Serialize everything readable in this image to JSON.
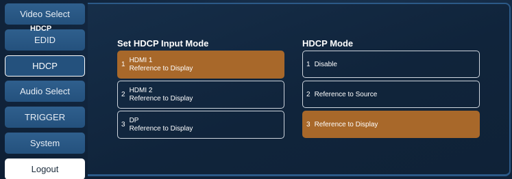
{
  "sidebar": {
    "items": [
      {
        "label": "Video Select",
        "active": false
      },
      {
        "label": "EDID",
        "active": false
      },
      {
        "label": "HDCP",
        "active": true
      },
      {
        "label": "Audio Select",
        "active": false
      },
      {
        "label": "TRIGGER",
        "active": false
      },
      {
        "label": "System",
        "active": false
      }
    ],
    "logout_label": "Logout"
  },
  "panel": {
    "title": "HDCP",
    "input_mode_heading": "Set HDCP Input Mode",
    "hdcp_mode_heading": "HDCP Mode",
    "inputs": [
      {
        "number": "1",
        "name": "HDMI 1",
        "mode": "Reference to Display",
        "selected": true
      },
      {
        "number": "2",
        "name": "HDMI 2",
        "mode": "Reference to Display",
        "selected": false
      },
      {
        "number": "3",
        "name": "DP",
        "mode": "Reference to Display",
        "selected": false
      }
    ],
    "modes": [
      {
        "number": "1",
        "label": "Disable",
        "selected": false
      },
      {
        "number": "2",
        "label": "Reference to Source",
        "selected": false
      },
      {
        "number": "3",
        "label": "Reference to Display",
        "selected": true
      }
    ]
  },
  "colors": {
    "selected": "#a8682a",
    "nav_button": "#24517d",
    "background": "#11253d"
  }
}
